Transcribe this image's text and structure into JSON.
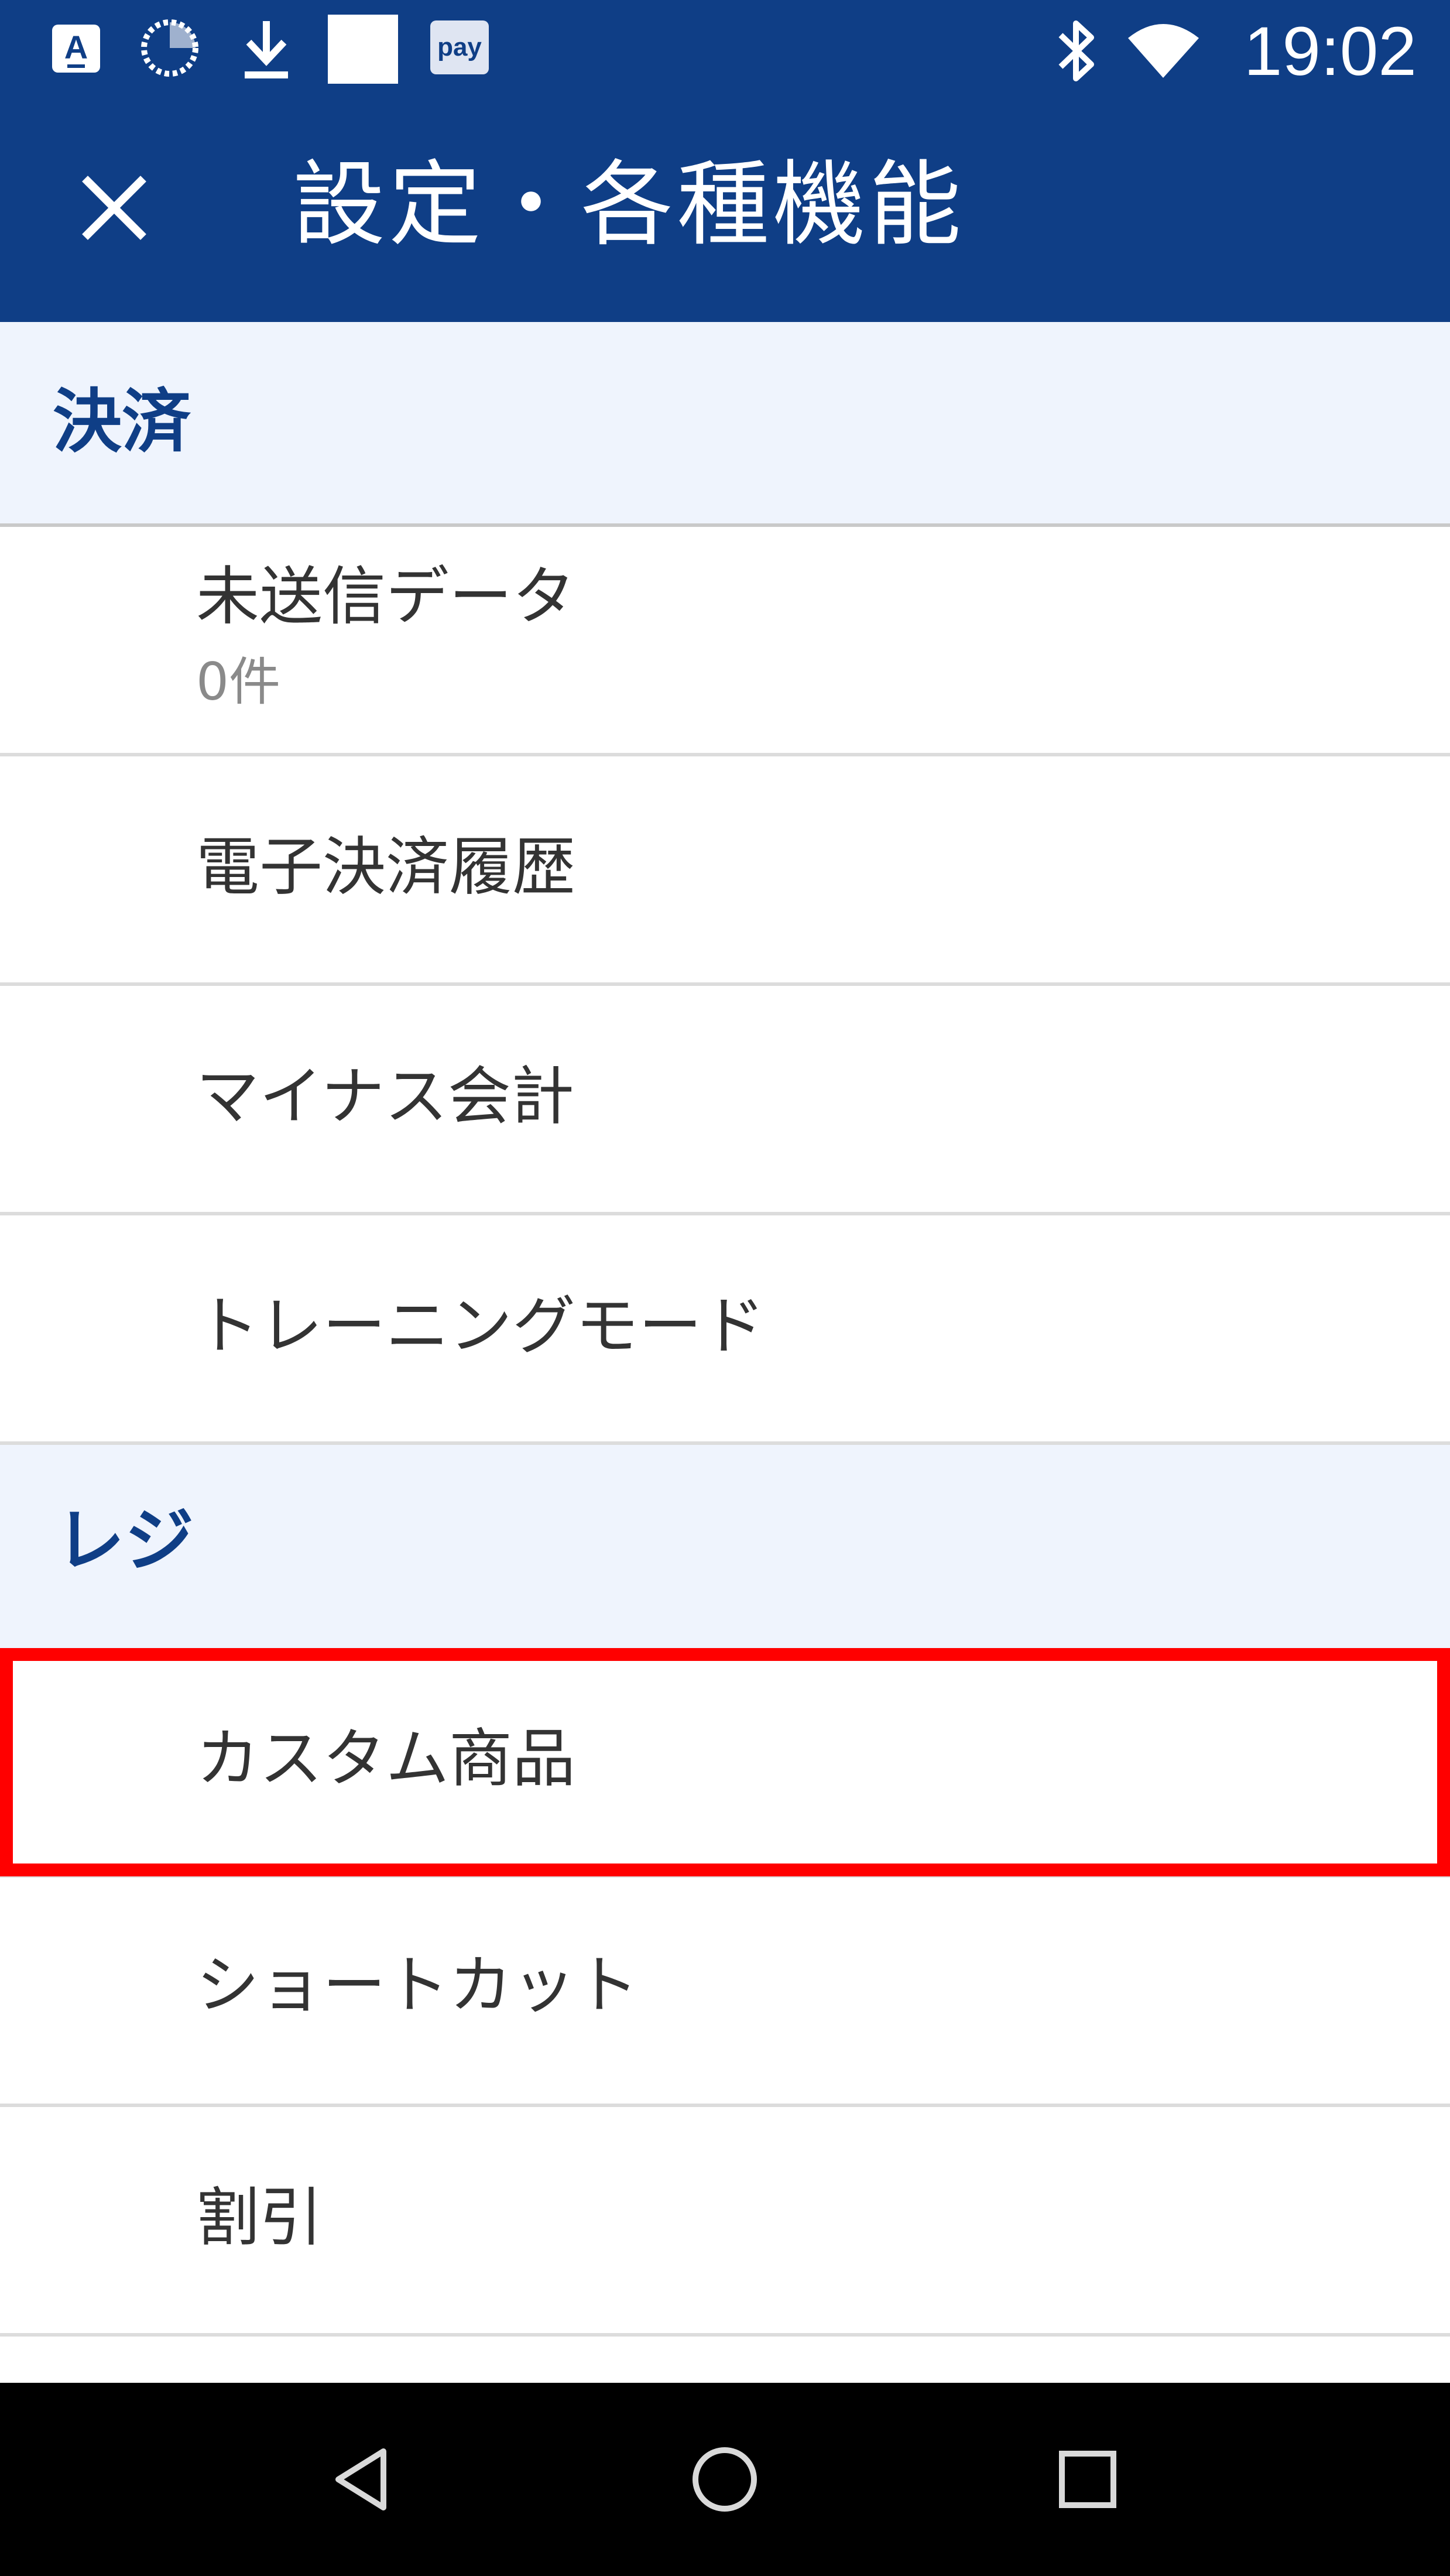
{
  "status_bar": {
    "time": "19:02",
    "icons": [
      "keyboard-a-icon",
      "sync-icon",
      "download-icon",
      "blank-notification-icon",
      "pay-icon",
      "bluetooth-icon",
      "wifi-icon"
    ],
    "pay_label": "pay"
  },
  "app_bar": {
    "title": "設定・各種機能",
    "close_icon": "close-icon",
    "background_color": "#0f3e86"
  },
  "sections": [
    {
      "title": "決済",
      "items": [
        {
          "label": "未送信データ",
          "sub": "0件"
        },
        {
          "label": "電子決済履歴"
        },
        {
          "label": "マイナス会計"
        },
        {
          "label": "トレーニングモード"
        }
      ]
    },
    {
      "title": "レジ",
      "items": [
        {
          "label": "カスタム商品",
          "highlighted": true
        },
        {
          "label": "ショートカット"
        },
        {
          "label": "割引"
        }
      ]
    }
  ],
  "nav_bar": {
    "icons": [
      "back-icon",
      "home-icon",
      "recents-icon"
    ]
  },
  "colors": {
    "primary": "#0f3e86",
    "section_bg": "#eff4fd",
    "highlight": "#ff0000"
  }
}
